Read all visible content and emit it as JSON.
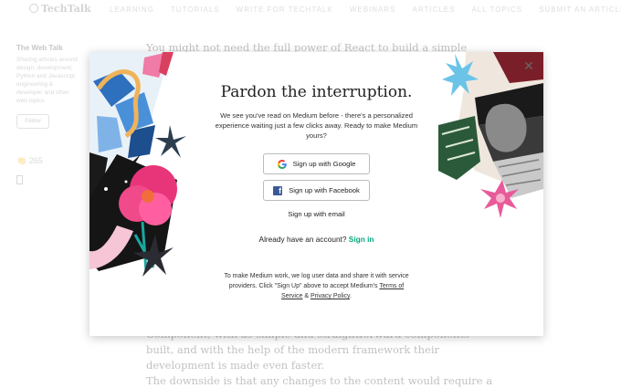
{
  "background": {
    "logo": "TechTalk",
    "nav_links": [
      "LEARNING",
      "TUTORIALS",
      "WRITE FOR TECHTALK",
      "WEBINARS",
      "ARTICLES",
      "ALL TOPICS",
      "SUBMIT AN ARTICLE"
    ],
    "pub_name": "The Web Talk",
    "pub_desc": "Sharing articles around design, development, Python and Javascript engineering & developer and other web topics",
    "follow_label": "Follow",
    "clap_count": "265",
    "text_top": "You might not need the full power of React to build a simple page...",
    "text_bottom_1": "Component, with as simple and straightforward components built, and with the help of the modern framework their development is made even faster.",
    "text_bottom_2": "The downside is that any changes to the content would require a developer"
  },
  "modal": {
    "title": "Pardon the interruption.",
    "subtitle": "We see you've read on Medium before - there's a personalized experience waiting just a few clicks away. Ready to make Medium yours?",
    "google_label": "Sign up with Google",
    "facebook_label": "Sign up with Facebook",
    "email_label": "Sign up with email",
    "have_account": "Already have an account?",
    "signin_label": "Sign in",
    "legal_pre": "To make Medium work, we log user data and share it with service providers. Click \"Sign Up\" above to accept Medium's",
    "terms_label": "Terms of Service",
    "legal_and": "&",
    "privacy_label": "Privacy Policy",
    "legal_end": ".",
    "close_icon": "close-icon"
  },
  "colors": {
    "accent_green": "#03a87c",
    "facebook_blue": "#3b5998"
  }
}
